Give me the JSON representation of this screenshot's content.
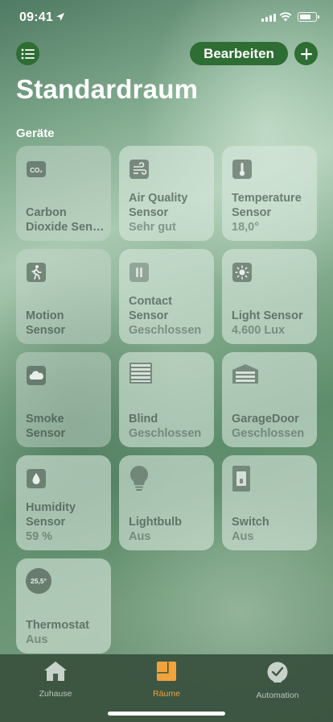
{
  "status_bar": {
    "time": "09:41"
  },
  "header": {
    "edit_label": "Bearbeiten",
    "title": "Standardraum",
    "section": "Geräte"
  },
  "tiles": [
    {
      "name": "Carbon Dioxide Sen…",
      "name_line1": "Carbon",
      "name_line2": "Dioxide Sen…",
      "status": "",
      "icon": "co2-icon"
    },
    {
      "name": "Air Quality Sensor",
      "name_line1": "Air Quality",
      "name_line2": "Sensor",
      "status": "Sehr gut",
      "icon": "air-quality-icon"
    },
    {
      "name": "Temperature Sensor",
      "name_line1": "Temperature",
      "name_line2": "Sensor",
      "status": "18,0°",
      "icon": "thermometer-icon"
    },
    {
      "name": "Motion Sensor",
      "name_line1": "Motion",
      "name_line2": "Sensor",
      "status": "",
      "icon": "motion-icon"
    },
    {
      "name": "Contact Sensor",
      "name_line1": "Contact",
      "name_line2": "Sensor",
      "status": "Geschlossen",
      "icon": "contact-icon"
    },
    {
      "name": "Light Sensor",
      "name_line1": "Light Sensor",
      "name_line2": "",
      "status": "4.600 Lux",
      "icon": "light-sensor-icon"
    },
    {
      "name": "Smoke Sensor",
      "name_line1": "Smoke",
      "name_line2": "Sensor",
      "status": "",
      "icon": "smoke-icon"
    },
    {
      "name": "Blind",
      "name_line1": "Blind",
      "name_line2": "",
      "status": "Geschlossen",
      "icon": "blind-icon"
    },
    {
      "name": "GarageDoor",
      "name_line1": "GarageDoor",
      "name_line2": "",
      "status": "Geschlossen",
      "icon": "garage-door-icon"
    },
    {
      "name": "Humidity Sensor",
      "name_line1": "Humidity",
      "name_line2": "Sensor",
      "status": "59 %",
      "icon": "humidity-icon"
    },
    {
      "name": "Lightbulb",
      "name_line1": "Lightbulb",
      "name_line2": "",
      "status": "Aus",
      "icon": "lightbulb-icon"
    },
    {
      "name": "Switch",
      "name_line1": "Switch",
      "name_line2": "",
      "status": "Aus",
      "icon": "switch-icon"
    },
    {
      "name": "Thermostat",
      "name_line1": "Thermostat",
      "name_line2": "",
      "status": "Aus",
      "icon": "thermostat-icon",
      "badge": "25,5°"
    }
  ],
  "tab_bar": {
    "tabs": [
      {
        "label": "Zuhause",
        "icon": "home-icon",
        "active": false
      },
      {
        "label": "Räume",
        "icon": "rooms-icon",
        "active": true
      },
      {
        "label": "Automation",
        "icon": "automation-icon",
        "active": false
      }
    ]
  },
  "colors": {
    "accent": "#2e6d33",
    "active_tab": "#f2a23a"
  }
}
